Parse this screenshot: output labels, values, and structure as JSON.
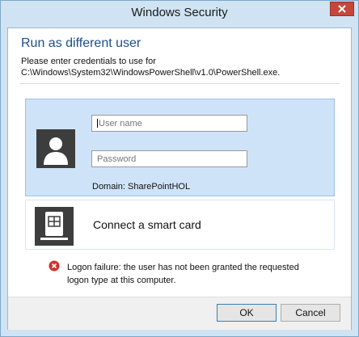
{
  "window": {
    "title": "Windows Security"
  },
  "dialog": {
    "heading": "Run as different user",
    "description_line1": "Please enter credentials to use for",
    "description_line2": "C:\\Windows\\System32\\WindowsPowerShell\\v1.0\\PowerShell.exe."
  },
  "credentials": {
    "username_placeholder": "User name",
    "password_placeholder": "Password",
    "domain_label": "Domain: SharePointHOL"
  },
  "smart_card": {
    "label": "Connect a smart card"
  },
  "error": {
    "line1": "Logon failure: the user has not been granted the requested",
    "line2": "logon type at this computer."
  },
  "buttons": {
    "ok_label": "OK",
    "cancel_label": "Cancel"
  },
  "icons": {
    "close": "close-icon",
    "avatar": "user-avatar-icon",
    "smart_card": "smart-card-icon",
    "error": "error-icon"
  },
  "colors": {
    "frame": "#cfe3f2",
    "heading": "#1c4e8a",
    "close_button": "#c7463c",
    "selected_tile": "#cfe3f8",
    "error_icon": "#d0322b"
  }
}
